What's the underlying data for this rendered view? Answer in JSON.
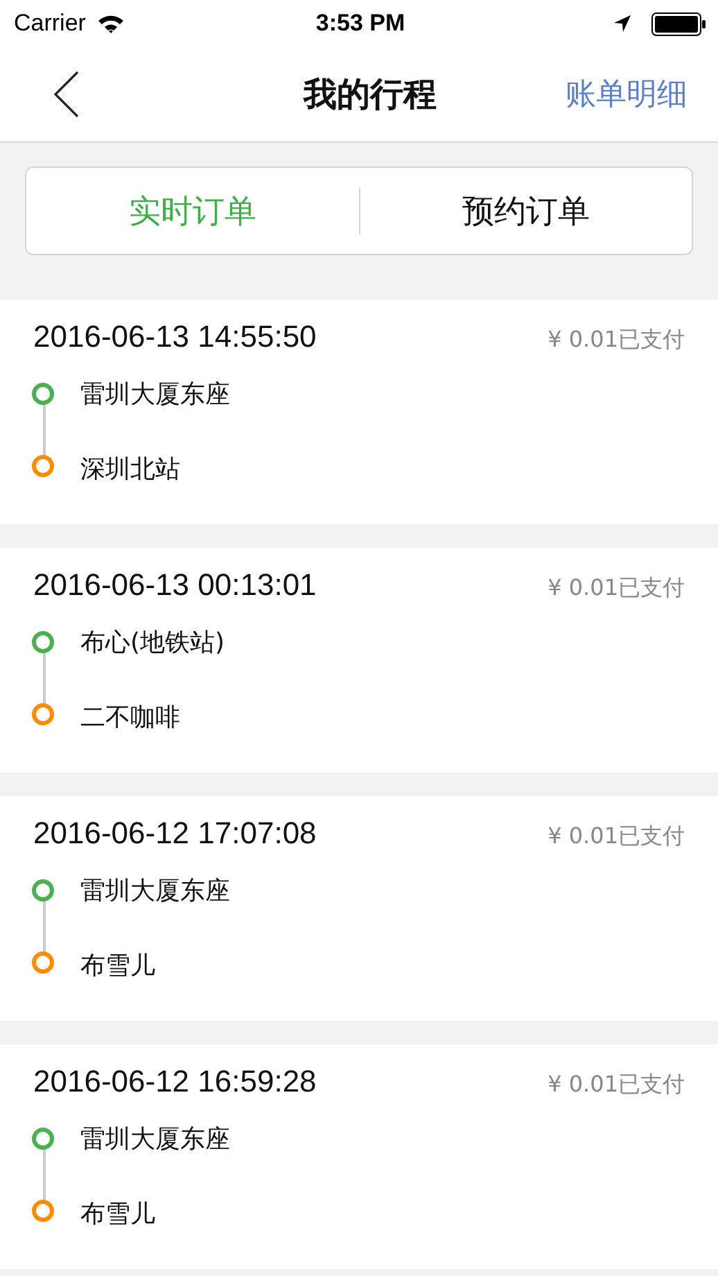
{
  "status_bar": {
    "carrier": "Carrier",
    "time": "3:53 PM"
  },
  "nav": {
    "title": "我的行程",
    "action": "账单明细"
  },
  "tabs": [
    {
      "label": "实时订单",
      "selected": true
    },
    {
      "label": "预约订单",
      "selected": false
    }
  ],
  "trips": [
    {
      "time": "2016-06-13 14:55:50",
      "price": "¥ 0.01已支付",
      "stops": [
        {
          "name": "雷圳大厦东座",
          "color": "#4caf50"
        },
        {
          "name": "深圳北站",
          "color": "#ff8c00"
        }
      ]
    },
    {
      "time": "2016-06-13 00:13:01",
      "price": "¥ 0.01已支付",
      "stops": [
        {
          "name": "布心(地铁站)",
          "color": "#4caf50"
        },
        {
          "name": "二不咖啡",
          "color": "#ff8c00"
        }
      ]
    },
    {
      "time": "2016-06-12 17:07:08",
      "price": "¥ 0.01已支付",
      "stops": [
        {
          "name": "雷圳大厦东座",
          "color": "#4caf50"
        },
        {
          "name": "布雪儿",
          "color": "#ff8c00"
        }
      ]
    },
    {
      "time": "2016-06-12 16:59:28",
      "price": "¥ 0.01已支付",
      "stops": [
        {
          "name": "雷圳大厦东座",
          "color": "#4caf50"
        },
        {
          "name": "布雪儿",
          "color": "#ff8c00"
        }
      ]
    }
  ]
}
